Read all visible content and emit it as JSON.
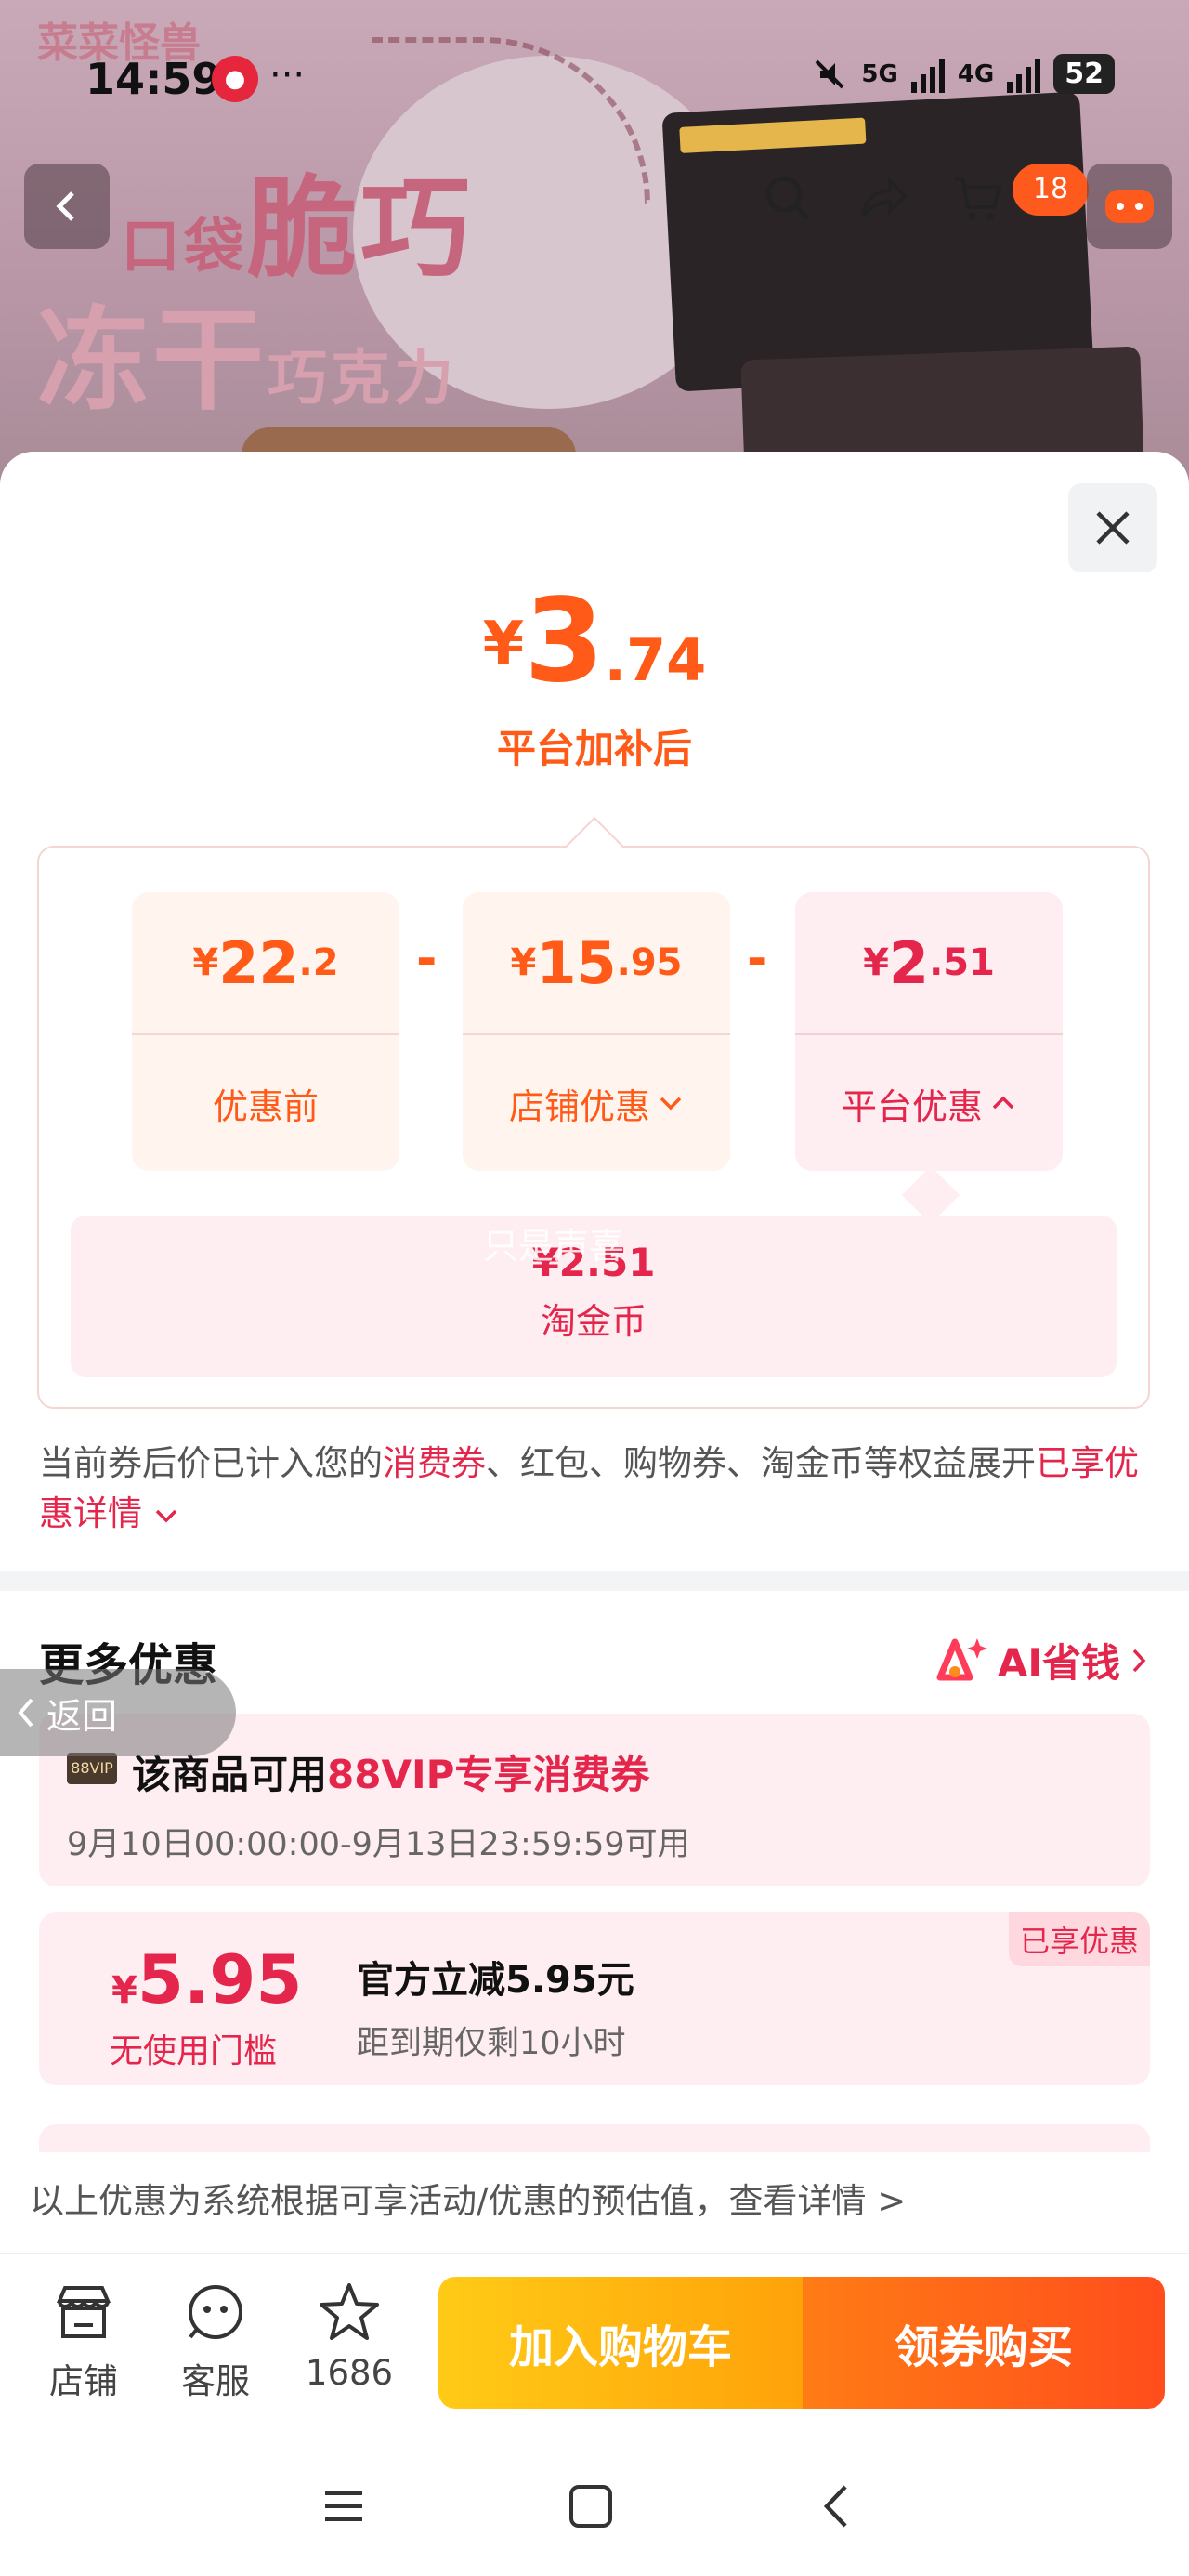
{
  "status_bar": {
    "time": "14:59",
    "network1": "5G",
    "network2": "4G",
    "battery": "52",
    "more": "···"
  },
  "background": {
    "brand": "菜菜怪兽",
    "title_line1_a": "口袋",
    "title_line1_b": "脆巧",
    "title_line2_a": "冻干",
    "title_line2_b": "巧克力",
    "pack_text": "口袋\n脆巧"
  },
  "header": {
    "cart_count": "18"
  },
  "price": {
    "currency": "¥",
    "integer": "3",
    "decimal": ".74",
    "subtitle": "平台加补后"
  },
  "breakdown": {
    "cards": [
      {
        "currency": "¥",
        "integer": "22",
        "decimal": ".2",
        "label": "优惠前"
      },
      {
        "currency": "¥",
        "integer": "15",
        "decimal": ".95",
        "label": "店铺优惠"
      },
      {
        "currency": "¥",
        "integer": "2",
        "decimal": ".51",
        "label": "平台优惠"
      }
    ],
    "minus": "-",
    "coin": {
      "value": "¥2.51",
      "label": "淘金币"
    },
    "watermark": "只是声喜"
  },
  "note": {
    "part1": "当前券后价已计入您的",
    "highlight1": "消费券",
    "part2": "、红包、购物券、淘金币等权益展开",
    "highlight2": "已享优惠详情"
  },
  "more": {
    "title": "更多优惠",
    "ai_label": "AI省钱",
    "back_label": "返回",
    "vip": {
      "tag": "88VIP",
      "prefix": "该商品可用",
      "highlight": "88VIP专享消费券",
      "time": "9月10日00:00:00-9月13日23:59:59可用"
    },
    "coupon": {
      "flag": "已享优惠",
      "currency": "¥",
      "amount": "5.95",
      "condition": "无使用门槛",
      "title": "官方立减5.95元",
      "expiry": "距到期仅剩10小时"
    },
    "disclaimer": "以上优惠为系统根据可享活动/优惠的预估值，查看详情 >"
  },
  "action_bar": {
    "shop": "店铺",
    "service": "客服",
    "favorites": "1686",
    "add_cart": "加入购物车",
    "buy": "领券购买"
  },
  "colors": {
    "accent_orange": "#ff5a17",
    "accent_red": "#e4264c"
  }
}
